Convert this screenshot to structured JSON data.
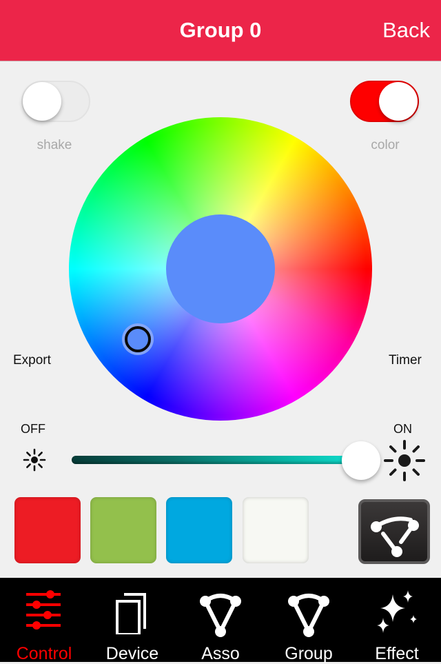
{
  "header": {
    "title": "Group 0",
    "back_label": "Back",
    "bar_color": "#ec2549"
  },
  "toggles": {
    "shake": {
      "label": "shake",
      "on": false
    },
    "color": {
      "label": "color",
      "on": true
    }
  },
  "side_actions": {
    "export_label": "Export",
    "timer_label": "Timer"
  },
  "color_wheel": {
    "selected_color": "#5a8cfa",
    "selector_icon": "ring-selector-icon"
  },
  "brightness": {
    "off_label": "OFF",
    "on_label": "ON",
    "value_percent": 100,
    "min_icon": "sun-small-icon",
    "max_icon": "sun-large-icon"
  },
  "preset_swatches": [
    {
      "name": "red",
      "color": "#ed1c24"
    },
    {
      "name": "green",
      "color": "#93c04c"
    },
    {
      "name": "blue",
      "color": "#00a8e0"
    },
    {
      "name": "white",
      "color": "#f7f8f3"
    }
  ],
  "assoc_button": {
    "icon": "association-icon"
  },
  "tabbar": {
    "active_color": "#fe0000",
    "tabs": [
      {
        "label": "Control",
        "icon": "sliders-icon",
        "active": true
      },
      {
        "label": "Device",
        "icon": "devices-icon",
        "active": false
      },
      {
        "label": "Asso",
        "icon": "association-icon",
        "active": false
      },
      {
        "label": "Group",
        "icon": "group-icon",
        "active": false
      },
      {
        "label": "Effect",
        "icon": "sparkles-icon",
        "active": false
      }
    ]
  }
}
